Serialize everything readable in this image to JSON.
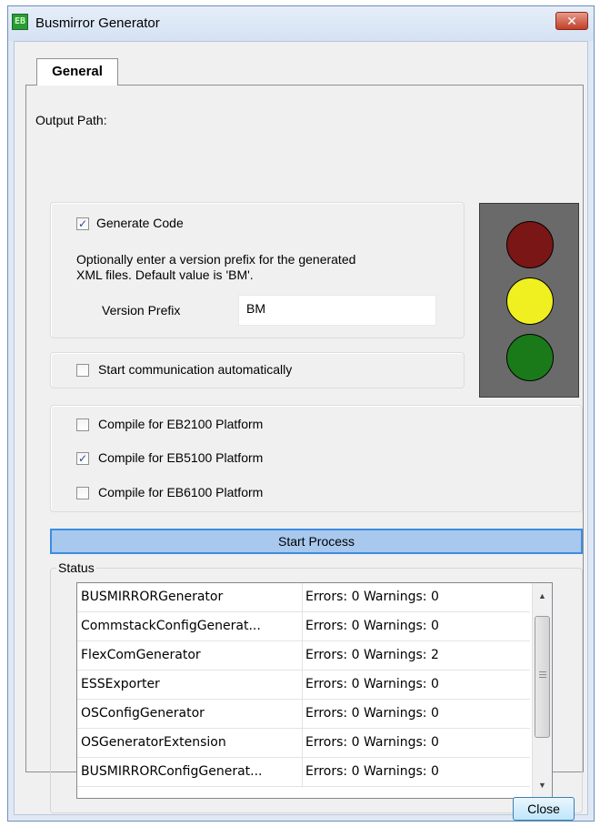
{
  "window": {
    "title": "Busmirror Generator",
    "app_icon_text": "EB",
    "close_glyph": "✕"
  },
  "tabs": [
    {
      "label": "General",
      "selected": true
    }
  ],
  "general": {
    "output_path_label": "Output Path:",
    "generate_code": {
      "label": "Generate Code",
      "checked": true
    },
    "version_hint_line1": "Optionally enter a version prefix for the generated",
    "version_hint_line2": "XML files. Default value is 'BM'.",
    "version_prefix_label": "Version Prefix",
    "version_prefix_value": "BM",
    "start_comm": {
      "label": "Start communication automatically",
      "checked": false
    },
    "platforms": [
      {
        "label": "Compile for EB2100 Platform",
        "checked": false
      },
      {
        "label": "Compile for EB5100 Platform",
        "checked": true
      },
      {
        "label": "Compile for EB6100 Platform",
        "checked": false
      }
    ],
    "start_process_label": "Start Process",
    "traffic_light": {
      "red": "#7a1616",
      "yellow": "#f0f020",
      "green": "#1a7a1a"
    }
  },
  "status": {
    "legend": "Status",
    "rows": [
      {
        "name": "BUSMIRRORGenerator",
        "result": "Errors: 0 Warnings: 0"
      },
      {
        "name": "CommstackConfigGenerat...",
        "result": "Errors: 0 Warnings: 0"
      },
      {
        "name": "FlexComGenerator",
        "result": "Errors: 0 Warnings: 2"
      },
      {
        "name": "ESSExporter",
        "result": "Errors: 0 Warnings: 0"
      },
      {
        "name": "OSConfigGenerator",
        "result": "Errors: 0 Warnings: 0"
      },
      {
        "name": "OSGeneratorExtension",
        "result": "Errors: 0 Warnings: 0"
      },
      {
        "name": "BUSMIRRORConfigGenerat...",
        "result": "Errors: 0 Warnings: 0"
      }
    ]
  },
  "footer": {
    "close_label": "Close"
  }
}
